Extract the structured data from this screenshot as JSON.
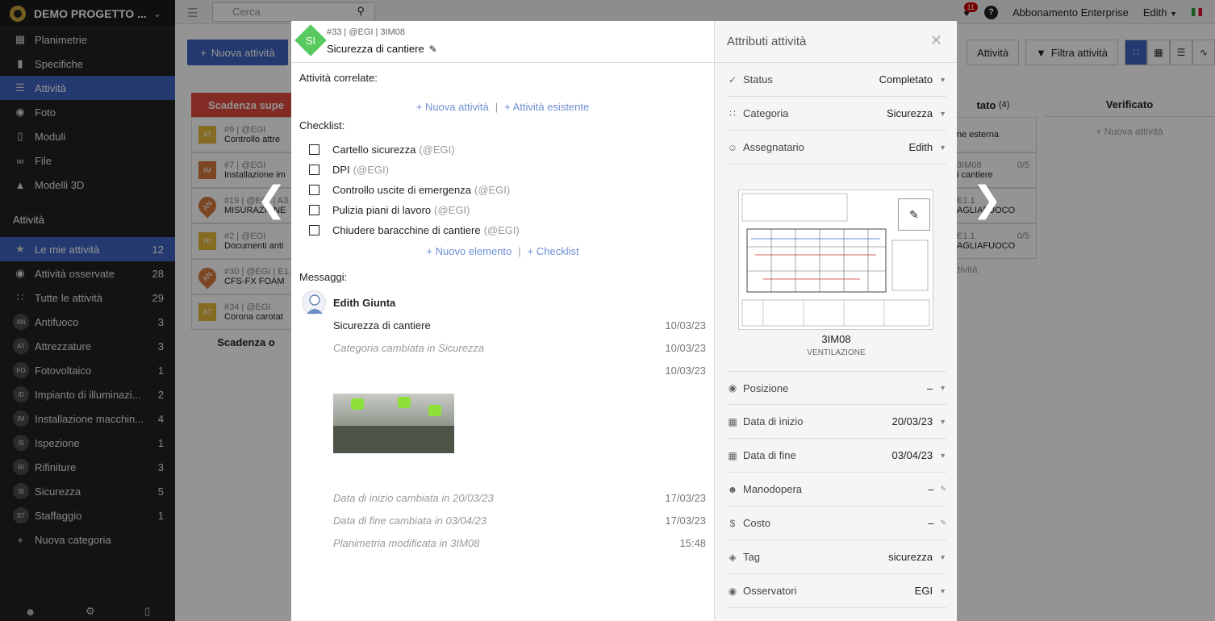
{
  "sidebar": {
    "project": "DEMO PROGETTO ...",
    "nav": [
      {
        "icon": "map-icon",
        "label": "Planimetrie",
        "active": false
      },
      {
        "icon": "book-icon",
        "label": "Specifiche",
        "active": false
      },
      {
        "icon": "list-icon",
        "label": "Attività",
        "active": true
      },
      {
        "icon": "camera-icon",
        "label": "Foto",
        "active": false
      },
      {
        "icon": "clipboard-icon",
        "label": "Moduli",
        "active": false
      },
      {
        "icon": "paperclip-icon",
        "label": "File",
        "active": false
      },
      {
        "icon": "cube-icon",
        "label": "Modelli 3D",
        "active": false
      }
    ],
    "section": "Attività",
    "filters": [
      {
        "icon": "star-icon",
        "label": "Le mie attività",
        "count": "12",
        "active": true
      },
      {
        "icon": "eye-icon",
        "label": "Attività osservate",
        "count": "28",
        "active": false
      },
      {
        "icon": "grid-icon",
        "label": "Tutte le attività",
        "count": "29",
        "active": false
      }
    ],
    "categories": [
      {
        "abbr": "AN",
        "label": "Antifuoco",
        "count": "3"
      },
      {
        "abbr": "AT",
        "label": "Attrezzature",
        "count": "3"
      },
      {
        "abbr": "FO",
        "label": "Fotovoltaico",
        "count": "1"
      },
      {
        "abbr": "ID",
        "label": "Impianto di illuminazi...",
        "count": "2"
      },
      {
        "abbr": "IM",
        "label": "Installazione macchin...",
        "count": "4"
      },
      {
        "abbr": "IS",
        "label": "Ispezione",
        "count": "1"
      },
      {
        "abbr": "RI",
        "label": "Rifiniture",
        "count": "3"
      },
      {
        "abbr": "SI",
        "label": "Sicurezza",
        "count": "5"
      },
      {
        "abbr": "ST",
        "label": "Staffaggio",
        "count": "1"
      }
    ],
    "new_category": "Nuova categoria"
  },
  "topbar": {
    "search_placeholder": "Cerca",
    "notifications": "11",
    "help": "?",
    "plan": "Abbonamento Enterprise",
    "user": "Edith"
  },
  "main": {
    "new_activity": "Nuova attività",
    "activities_btn": "Attività",
    "filter_btn": "Filtra attività",
    "col1_header": "Scadenza supe",
    "cards": [
      {
        "abbr": "AT",
        "color": "#e6b93a",
        "meta": "#9 | @EGI",
        "title": "Controllo attre"
      },
      {
        "abbr": "IM",
        "color": "#d5793a",
        "meta": "#7 | @EGI",
        "title": "Installazione im"
      },
      {
        "abbr": "AN",
        "color": "#d5793a",
        "meta": "#19 | @EGI | A3.",
        "title": "MISURAZIONE"
      },
      {
        "abbr": "RI",
        "color": "#e6b93a",
        "meta": "#2 | @EGI",
        "title": "Documenti anti"
      },
      {
        "abbr": "AN",
        "color": "#d5793a",
        "meta": "#30 | @EGI | E1.1",
        "title": "CFS-FX FOAM"
      },
      {
        "abbr": "AT",
        "color": "#e6b93a",
        "meta": "#34 | @EGI",
        "title": "Corona carotat"
      }
    ],
    "col1_footer": "Scadenza o",
    "col3_header": "tato",
    "col3_count": "(4)",
    "col3_items": [
      {
        "line1": "ne esterna",
        "line2": ""
      },
      {
        "line1": "3IM08",
        "badge": "0/5",
        "line2": "i cantiere"
      },
      {
        "line1": "E1.1",
        "badge": "",
        "line2": "AGLIAFUOCO"
      },
      {
        "line1": "E1.1",
        "badge": "0/5",
        "line2": "AGLIAFUOCO"
      }
    ],
    "col3_footer": "attività",
    "col4_header": "Verificato",
    "col4_new": "+ Nuova attività"
  },
  "modal": {
    "badge": "SI",
    "meta": "#33 | @EGI | 3IM08",
    "title": "Sicurezza di cantiere",
    "related_label": "Attività correlate:",
    "new_activity_link": "+ Nuova attività",
    "existing_activity_link": "+ Attività esistente",
    "checklist_label": "Checklist:",
    "checklist": [
      {
        "text": "Cartello sicurezza",
        "user": "(@EGI)"
      },
      {
        "text": "DPI",
        "user": "(@EGI)"
      },
      {
        "text": "Controllo uscite di emergenza",
        "user": "(@EGI)"
      },
      {
        "text": "Pulizia piani di lavoro",
        "user": "(@EGI)"
      },
      {
        "text": "Chiudere baracchine di cantiere",
        "user": "(@EGI)"
      }
    ],
    "new_item_link": "+ Nuovo elemento",
    "checklist_link": "+ Checklist",
    "messages_label": "Messaggi:",
    "author": "Edith Giunta",
    "messages": [
      {
        "text": "Sicurezza di cantiere",
        "date": "10/03/23",
        "italic": false
      },
      {
        "text": "Categoria cambiata in Sicurezza",
        "date": "10/03/23",
        "italic": true
      },
      {
        "text": "",
        "date": "10/03/23",
        "italic": false
      }
    ],
    "log": [
      {
        "text": "Data di inizio cambiata in 20/03/23",
        "date": "17/03/23"
      },
      {
        "text": "Data di fine cambiata in 03/04/23",
        "date": "17/03/23"
      },
      {
        "text": "Planimetria modificata in 3IM08",
        "date": "15:48"
      }
    ],
    "attributes_title": "Attributi attività",
    "status_label": "Status",
    "status_value": "Completato",
    "category_label": "Categoria",
    "category_value": "Sicurezza",
    "assignee_label": "Assegnatario",
    "assignee_value": "Edith",
    "plan_name": "3IM08",
    "plan_category": "VENTILAZIONE",
    "position_label": "Posizione",
    "position_value": "–",
    "start_label": "Data di inizio",
    "start_value": "20/03/23",
    "end_label": "Data di fine",
    "end_value": "03/04/23",
    "labor_label": "Manodopera",
    "labor_value": "–",
    "cost_label": "Costo",
    "cost_value": "–",
    "tag_label": "Tag",
    "tag_value": "sicurezza",
    "observers_label": "Osservatori",
    "observers_value": "EGI"
  },
  "colors": {
    "accent": "#3d63c0",
    "overdue": "#e04a3f",
    "category_si": "#58c95e",
    "link": "#6e8fd4"
  }
}
